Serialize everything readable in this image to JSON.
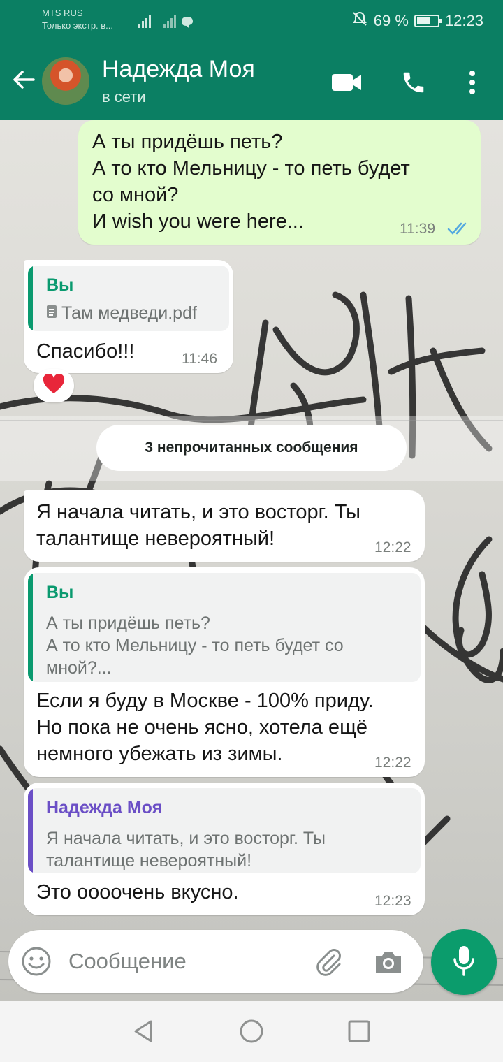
{
  "status_bar": {
    "carrier": "MTS RUS",
    "carrier_sub": "Только экстр. в...",
    "battery_text": "69 %",
    "battery_level": 0.69,
    "time": "12:23"
  },
  "header": {
    "contact_name": "Надежда Моя",
    "status": "в сети"
  },
  "messages": {
    "m1": {
      "line1": "А ты придёшь петь?",
      "line2": "А то кто Мельницу - то петь будет",
      "line3": "со мной?",
      "line4": "И  wish you were here...",
      "time": "11:39"
    },
    "m2": {
      "quote_sender": "Вы",
      "quote_file": "Там медведи.pdf",
      "text": "Спасибо!!!",
      "time": "11:46",
      "reaction": "❤️"
    },
    "unread_label": "3 непрочитанных сообщения",
    "m3": {
      "line1": "Я начала читать, и это восторг. Ты",
      "line2": "талантище невероятный!",
      "time": "12:22"
    },
    "m4": {
      "quote_sender": "Вы",
      "quote_line1": "А ты придёшь петь?",
      "quote_line2": "А то кто Мельницу - то петь будет со",
      "quote_line3": "мной?...",
      "line1": "Если я буду в Москве - 100% приду.",
      "line2": "Но пока не очень ясно, хотела ещё",
      "line3": "немного убежать из зимы.",
      "time": "12:22"
    },
    "m5": {
      "quote_sender": "Надежда Моя",
      "quote_line1": "Я начала читать, и это восторг. Ты",
      "quote_line2": "талантище невероятный!",
      "text": "Это оооочень вкусно.",
      "time": "12:23"
    }
  },
  "composer": {
    "placeholder": "Сообщение"
  },
  "colors": {
    "header": "#0b7f63",
    "outgoing_bubble": "#e3fdce",
    "incoming_bubble": "#ffffff",
    "quote_you": "#0a9a6f",
    "quote_contact": "#6b4fc6",
    "read_ticks": "#53a8e0",
    "mic_button": "#0b9c6c"
  },
  "icons": [
    "back-arrow-icon",
    "video-call-icon",
    "phone-icon",
    "more-vert-icon",
    "double-check-icon",
    "document-icon",
    "heart-icon",
    "emoji-icon",
    "attach-icon",
    "camera-icon",
    "mic-icon",
    "nav-back-icon",
    "nav-home-icon",
    "nav-recents-icon"
  ]
}
